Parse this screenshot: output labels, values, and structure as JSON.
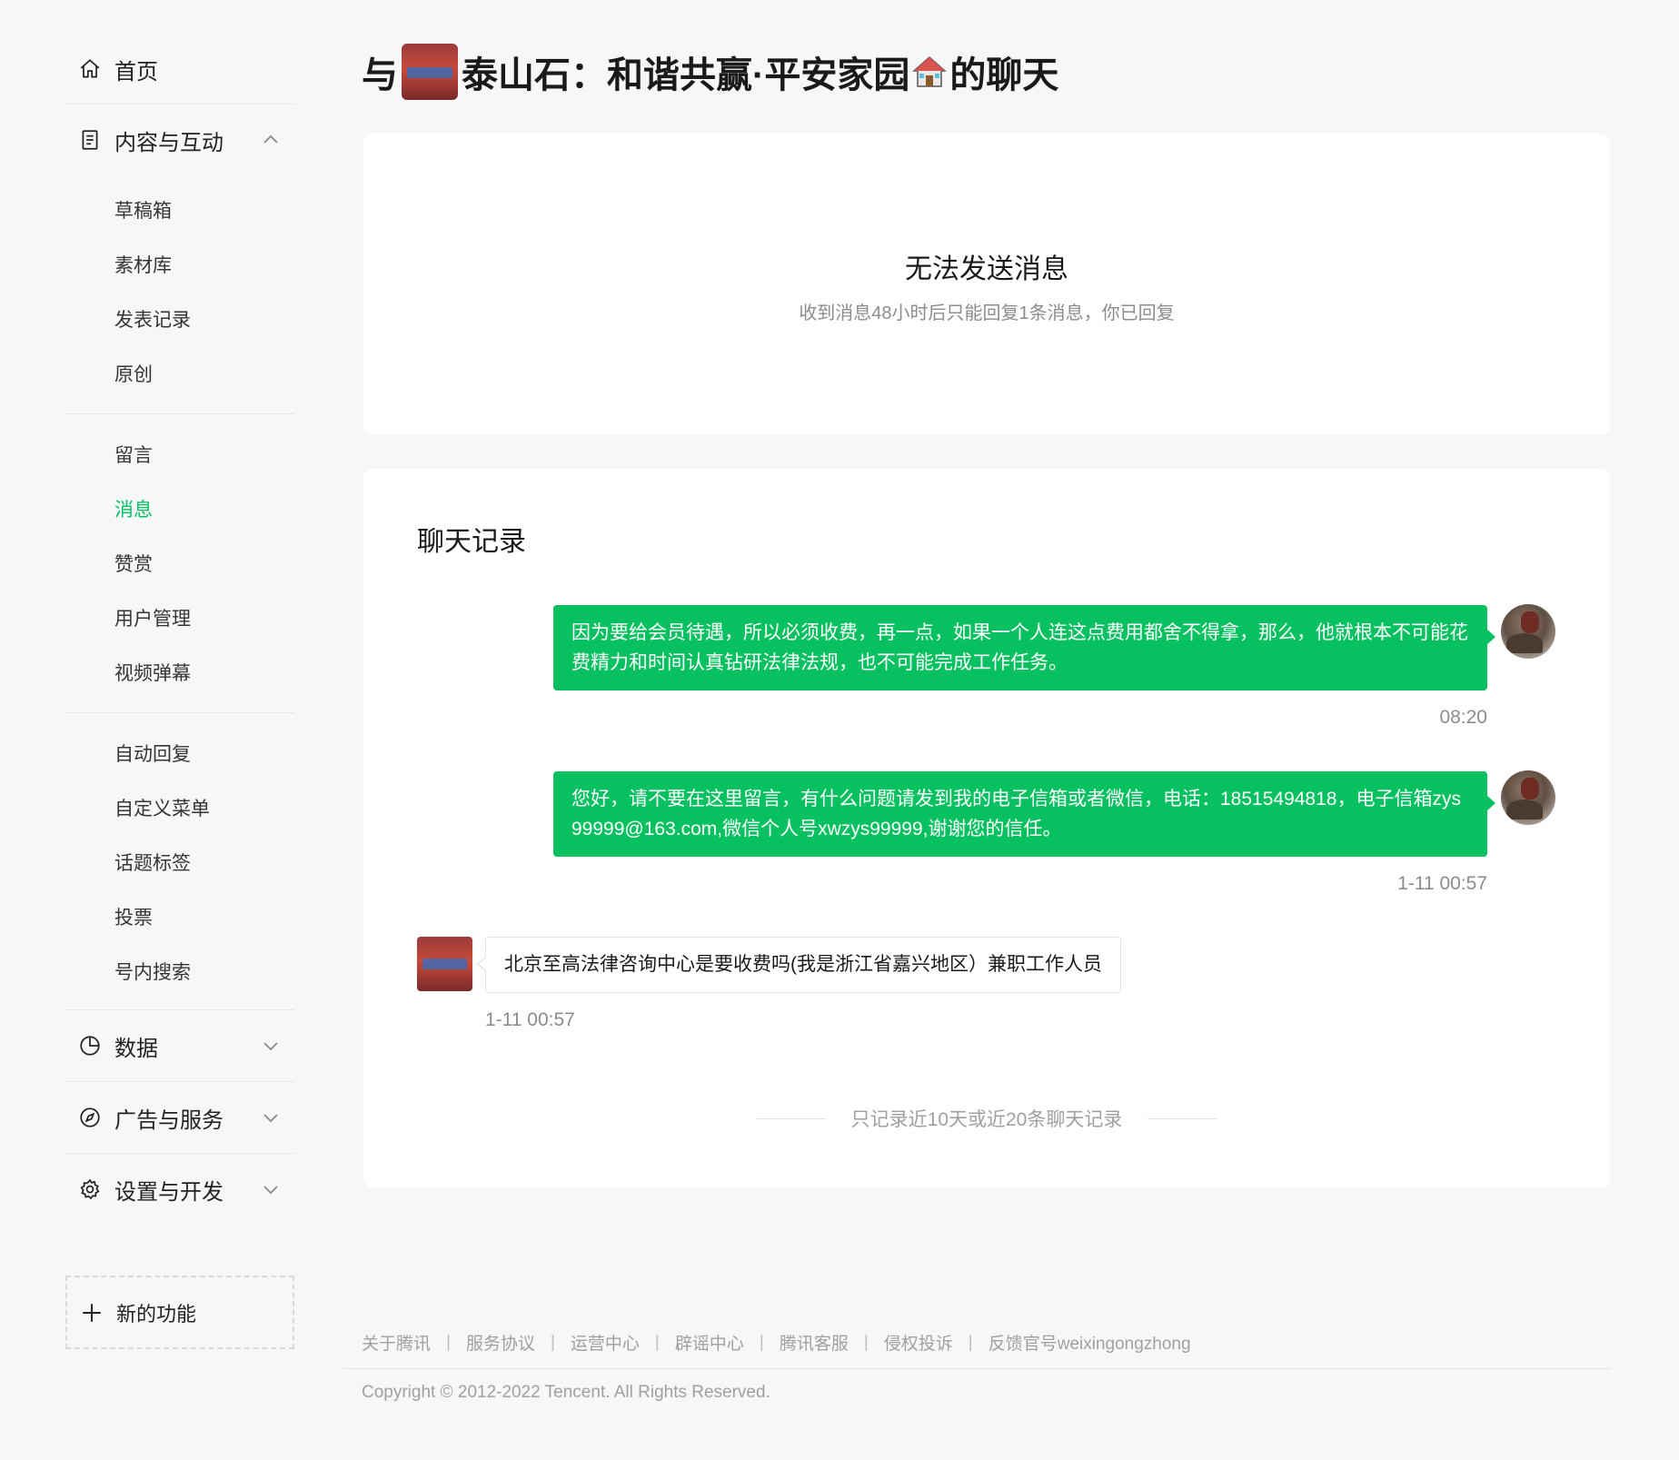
{
  "sidebar": {
    "home": {
      "label": "首页",
      "icon": "home-icon"
    },
    "content_group": {
      "label": "内容与互动",
      "icon": "document-icon",
      "expanded": true
    },
    "content_items_a": [
      "草稿箱",
      "素材库",
      "发表记录",
      "原创"
    ],
    "content_items_b": [
      "留言",
      "消息",
      "赞赏",
      "用户管理",
      "视频弹幕"
    ],
    "content_items_c": [
      "自动回复",
      "自定义菜单",
      "话题标签",
      "投票",
      "号内搜索"
    ],
    "active_item": "消息",
    "data_group": {
      "label": "数据",
      "icon": "pie-chart-icon"
    },
    "ads_group": {
      "label": "广告与服务",
      "icon": "compass-icon"
    },
    "settings_group": {
      "label": "设置与开发",
      "icon": "gear-icon"
    },
    "new_feature": {
      "label": "新的功能",
      "icon": "plus-icon"
    }
  },
  "page": {
    "title_prefix": "与",
    "title_name": "泰山石：和谐共赢·平安家园",
    "title_suffix": "的聊天"
  },
  "notice": {
    "title": "无法发送消息",
    "desc": "收到消息48小时后只能回复1条消息，你已回复"
  },
  "chat": {
    "title": "聊天记录",
    "messages": [
      {
        "direction": "out",
        "text": "因为要给会员待遇，所以必须收费，再一点，如果一个人连这点费用都舍不得拿，那么，他就根本不可能花费精力和时间认真钻研法律法规，也不可能完成工作任务。",
        "time": "08:20"
      },
      {
        "direction": "out",
        "text": "您好，请不要在这里留言，有什么问题请发到我的电子信箱或者微信，电话：18515494818，电子信箱zys99999@163.com,微信个人号xwzys99999,谢谢您的信任。",
        "time": "1-11 00:57"
      },
      {
        "direction": "in",
        "text": "北京至高法律咨询中心是要收费吗(我是浙江省嘉兴地区）兼职工作人员",
        "time": "1-11 00:57"
      }
    ],
    "record_note": "只记录近10天或近20条聊天记录"
  },
  "footer": {
    "links": [
      "关于腾讯",
      "服务协议",
      "运营中心",
      "辟谣中心",
      "腾讯客服",
      "侵权投诉",
      "反馈官号weixingongzhong"
    ],
    "separator": "|",
    "copyright": "Copyright © 2012-2022 Tencent. All Rights Reserved."
  },
  "colors": {
    "accent": "#07c160",
    "background": "#f6f7f8"
  }
}
